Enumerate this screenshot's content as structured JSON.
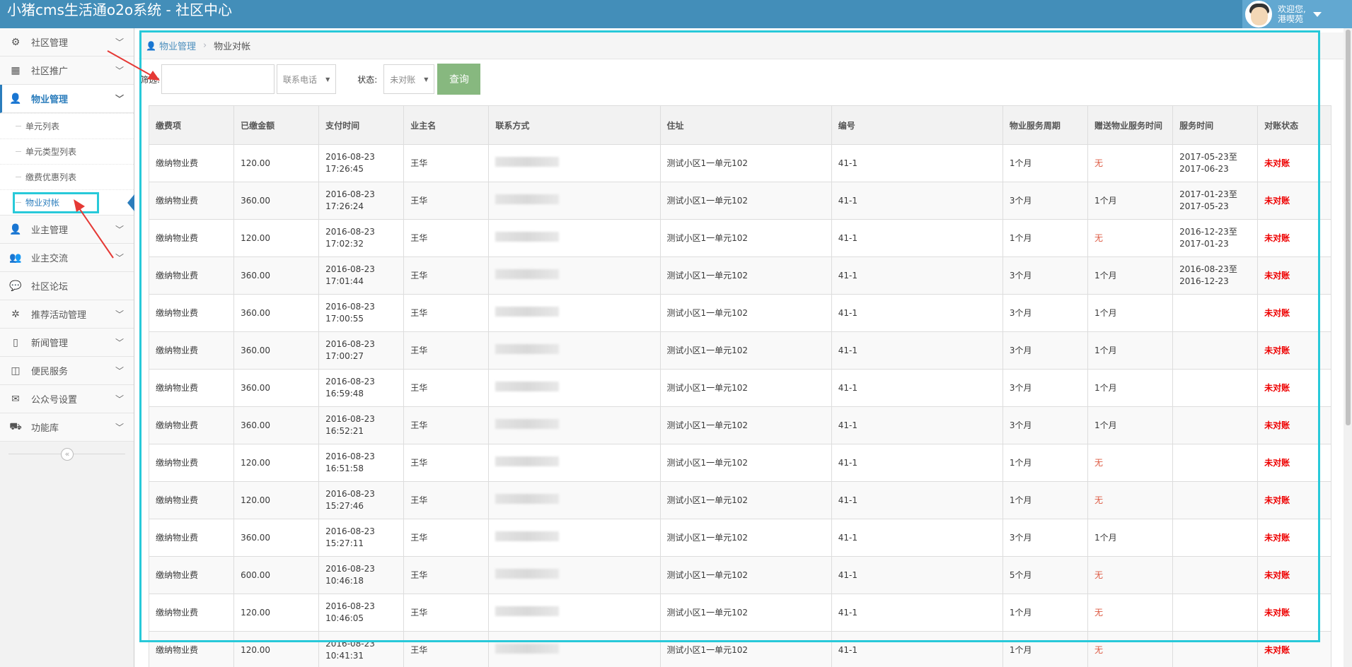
{
  "app": {
    "title": "小猪cms生活通o2o系统 - 社区中心"
  },
  "user": {
    "welcome_line1": "欢迎您,",
    "welcome_line2": "港喫苑"
  },
  "sidebar": {
    "items": [
      {
        "label": "社区管理",
        "icon": "gear-icon",
        "glyph": "⚙"
      },
      {
        "label": "社区推广",
        "icon": "qrcode-icon",
        "glyph": "▦"
      },
      {
        "label": "物业管理",
        "icon": "user-icon",
        "glyph": "👤"
      },
      {
        "label": "业主管理",
        "icon": "user-icon",
        "glyph": "👤"
      },
      {
        "label": "业主交流",
        "icon": "users-icon",
        "glyph": "👥"
      },
      {
        "label": "社区论坛",
        "icon": "comments-icon",
        "glyph": "💬"
      },
      {
        "label": "推荐活动管理",
        "icon": "life-ring-icon",
        "glyph": "✲"
      },
      {
        "label": "新闻管理",
        "icon": "tablet-icon",
        "glyph": "▯"
      },
      {
        "label": "便民服务",
        "icon": "columns-icon",
        "glyph": "◫"
      },
      {
        "label": "公众号设置",
        "icon": "wechat-icon",
        "glyph": "✉"
      },
      {
        "label": "功能库",
        "icon": "cart-icon",
        "glyph": "⛟"
      }
    ],
    "submenu": [
      "单元列表",
      "单元类型列表",
      "缴费优惠列表",
      "物业对帐"
    ],
    "collapse": "«"
  },
  "breadcrumb": {
    "parent": "物业管理",
    "current": "物业对帐"
  },
  "filter": {
    "search_label": "筛选:",
    "search_value": "",
    "field_select": "联系电话",
    "state_label": "状态:",
    "state_select": "未对账",
    "query_button": "查询"
  },
  "table": {
    "headers": [
      "缴费项",
      "已缴金额",
      "支付时间",
      "业主名",
      "联系方式",
      "住址",
      "编号",
      "物业服务周期",
      "赠送物业服务时间",
      "服务时间",
      "对账状态"
    ],
    "rows": [
      [
        "缴纳物业费",
        "120.00",
        "2016-08-23",
        "17:26:45",
        "王华",
        "测试小区1一单元102",
        "41-1",
        "1个月",
        "无",
        "2017-05-23至",
        "2017-06-23",
        "未对账"
      ],
      [
        "缴纳物业费",
        "360.00",
        "2016-08-23",
        "17:26:24",
        "王华",
        "测试小区1一单元102",
        "41-1",
        "3个月",
        "1个月",
        "2017-01-23至",
        "2017-05-23",
        "未对账"
      ],
      [
        "缴纳物业费",
        "120.00",
        "2016-08-23",
        "17:02:32",
        "王华",
        "测试小区1一单元102",
        "41-1",
        "1个月",
        "无",
        "2016-12-23至",
        "2017-01-23",
        "未对账"
      ],
      [
        "缴纳物业费",
        "360.00",
        "2016-08-23",
        "17:01:44",
        "王华",
        "测试小区1一单元102",
        "41-1",
        "3个月",
        "1个月",
        "2016-08-23至",
        "2016-12-23",
        "未对账"
      ],
      [
        "缴纳物业费",
        "360.00",
        "2016-08-23",
        "17:00:55",
        "王华",
        "测试小区1一单元102",
        "41-1",
        "3个月",
        "1个月",
        "",
        "",
        "未对账"
      ],
      [
        "缴纳物业费",
        "360.00",
        "2016-08-23",
        "17:00:27",
        "王华",
        "测试小区1一单元102",
        "41-1",
        "3个月",
        "1个月",
        "",
        "",
        "未对账"
      ],
      [
        "缴纳物业费",
        "360.00",
        "2016-08-23",
        "16:59:48",
        "王华",
        "测试小区1一单元102",
        "41-1",
        "3个月",
        "1个月",
        "",
        "",
        "未对账"
      ],
      [
        "缴纳物业费",
        "360.00",
        "2016-08-23",
        "16:52:21",
        "王华",
        "测试小区1一单元102",
        "41-1",
        "3个月",
        "1个月",
        "",
        "",
        "未对账"
      ],
      [
        "缴纳物业费",
        "120.00",
        "2016-08-23",
        "16:51:58",
        "王华",
        "测试小区1一单元102",
        "41-1",
        "1个月",
        "无",
        "",
        "",
        "未对账"
      ],
      [
        "缴纳物业费",
        "120.00",
        "2016-08-23",
        "15:27:46",
        "王华",
        "测试小区1一单元102",
        "41-1",
        "1个月",
        "无",
        "",
        "",
        "未对账"
      ],
      [
        "缴纳物业费",
        "360.00",
        "2016-08-23",
        "15:27:11",
        "王华",
        "测试小区1一单元102",
        "41-1",
        "3个月",
        "1个月",
        "",
        "",
        "未对账"
      ],
      [
        "缴纳物业费",
        "600.00",
        "2016-08-23",
        "10:46:18",
        "王华",
        "测试小区1一单元102",
        "41-1",
        "5个月",
        "无",
        "",
        "",
        "未对账"
      ],
      [
        "缴纳物业费",
        "120.00",
        "2016-08-23",
        "10:46:05",
        "王华",
        "测试小区1一单元102",
        "41-1",
        "1个月",
        "无",
        "",
        "",
        "未对账"
      ],
      [
        "缴纳物业费",
        "120.00",
        "2016-08-23",
        "10:41:31",
        "王华",
        "测试小区1一单元102",
        "41-1",
        "1个月",
        "无",
        "",
        "",
        "未对账"
      ]
    ]
  },
  "colors": {
    "topbar": "#438eb9",
    "highlight": "#28c9d9",
    "query": "#87b87f",
    "unsettled": "#ee0000",
    "none": "#dd5a43"
  }
}
